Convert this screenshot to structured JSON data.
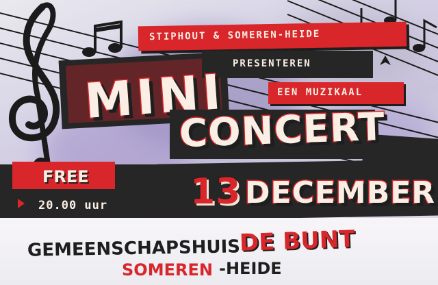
{
  "presenters": "STIPHOUT & SOMEREN-HEIDE",
  "presenteren": "PRESENTEREN",
  "een_muzikaal": "EEN MUZIKAAL",
  "title_line1": "MINI",
  "title_line2": "CONCERT",
  "free_label": "FREE",
  "time": "20.00 uur",
  "date_number": "13",
  "date_month": "DECEMBER",
  "venue_line1": "GEMEENSCHAPSHUIS",
  "venue_highlight": "DE BUNT",
  "place_red": "SOMEREN",
  "place_rest": "-HEIDE",
  "colors": {
    "accent_red": "#d8262b",
    "band_dark": "#262626",
    "cream": "#fbeee4"
  },
  "icons": [
    "treble-clef-icon",
    "music-note-icon",
    "music-staff-icon"
  ]
}
